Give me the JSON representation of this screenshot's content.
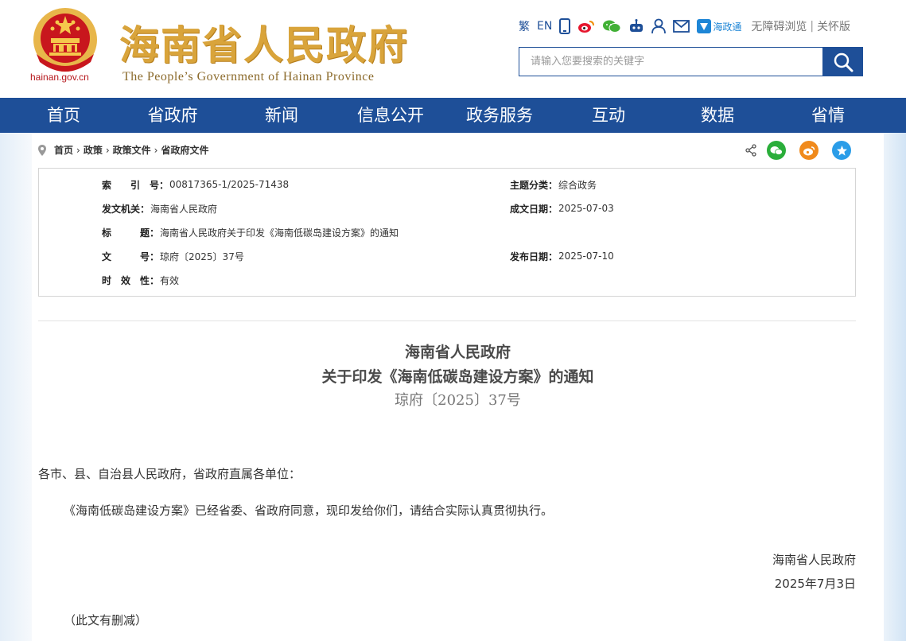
{
  "header": {
    "domain": "hainan.gov.cn",
    "title": "海南省人民政府",
    "subtitle": "The People’s Government  of Hainan Province",
    "toolbar": {
      "traditional": "繁",
      "english": "EN",
      "hzt": "海政通",
      "accessible": "无障碍浏览",
      "separator": "|",
      "elderly": "关怀版",
      "icons": [
        "traditional-icon",
        "mobile-icon",
        "weibo-icon",
        "wechat-icon",
        "robot-icon",
        "user-icon",
        "mail-icon",
        "hzt-icon"
      ]
    },
    "search": {
      "placeholder": "请输入您要搜索的关键字",
      "value": ""
    }
  },
  "nav": [
    "首页",
    "省政府",
    "新闻",
    "信息公开",
    "政务服务",
    "互动",
    "数据",
    "省情"
  ],
  "breadcrumb": [
    "首页",
    "政策",
    "政策文件",
    "省政府文件"
  ],
  "share": [
    "share-icon",
    "wechat-icon",
    "weibo-icon",
    "qzone-icon"
  ],
  "info": {
    "index_label": "索　　引　号：",
    "index": "00817365-1/2025-71438",
    "topic_label": "主题分类：",
    "topic": "综合政务",
    "issuer_label": "发文机关：",
    "issuer": "海南省人民政府",
    "date_label": "成文日期：",
    "date": "2025-07-03",
    "title_label": "标　　　题：",
    "title": "海南省人民政府关于印发《海南低碳岛建设方案》的通知",
    "docno_label": "文　　　号：",
    "docno": "琼府〔2025〕37号",
    "pubdate_label": "发布日期：",
    "pubdate": "2025-07-10",
    "valid_label": "时　效　性：",
    "valid": "有效"
  },
  "doc": {
    "title_line1": "海南省人民政府",
    "title_line2": "关于印发《海南低碳岛建设方案》的通知",
    "number": "琼府〔2025〕37号",
    "salutation": "各市、县、自治县人民政府，省政府直属各单位：",
    "body": "《海南低碳岛建设方案》已经省委、省政府同意，现印发给你们，请结合实际认真贯彻执行。",
    "signer": "海南省人民政府",
    "sign_date": "2025年7月3日",
    "note": "（此文有删减）"
  },
  "colors": {
    "brand_blue": "#1e4f98",
    "title_gold": "#d9a43b",
    "emblem_red": "#c8161d"
  }
}
